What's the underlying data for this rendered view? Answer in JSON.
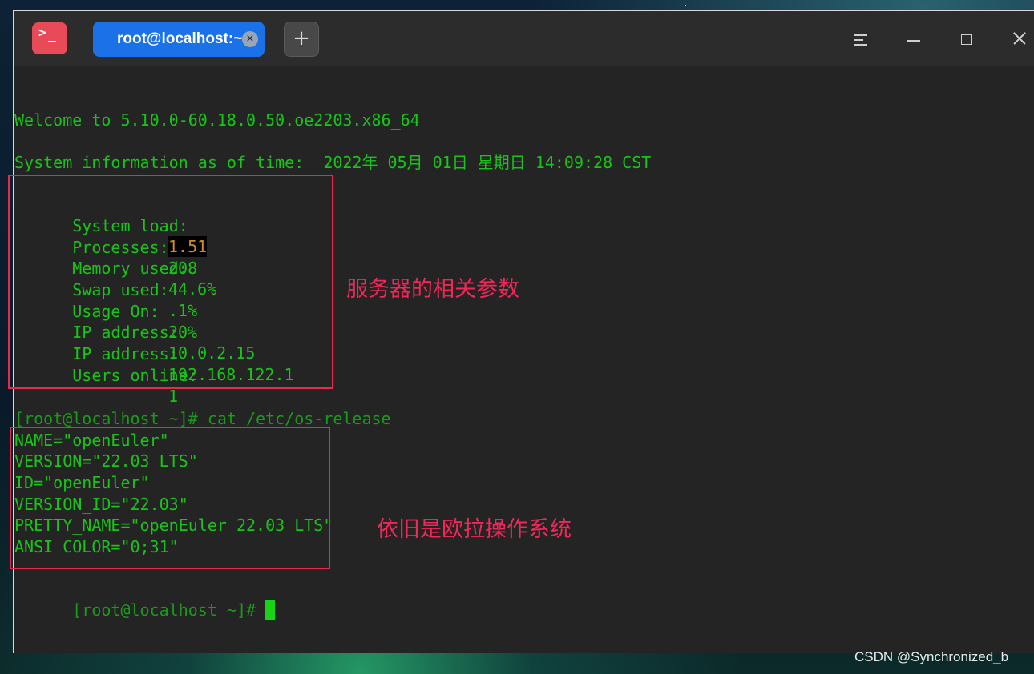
{
  "window": {
    "tab_title": "root@localhost:~",
    "tab_close_symbol": "×",
    "new_tab_symbol": "+"
  },
  "terminal": {
    "welcome": "Welcome to 5.10.0-60.18.0.50.oe2203.x86_64",
    "sysinfo": "System information as of time:  2022年 05月 01日 星期日 14:09:28 CST",
    "stats": [
      {
        "label": "System load:",
        "value": "1.51"
      },
      {
        "label": "Processes:",
        "value": "208"
      },
      {
        "label": "Memory used:",
        "value": "44.6%"
      },
      {
        "label": "Swap used:",
        "value": ".1%"
      },
      {
        "label": "Usage On:",
        "value": "20%"
      },
      {
        "label": "IP address:",
        "value": "10.0.2.15"
      },
      {
        "label": "IP address:",
        "value": "192.168.122.1"
      },
      {
        "label": "Users online:",
        "value": "1"
      }
    ],
    "prompt1": "[root@localhost ~]# cat /etc/os-release",
    "os_release": [
      "NAME=\"openEuler\"",
      "VERSION=\"22.03 LTS\"",
      "ID=\"openEuler\"",
      "VERSION_ID=\"22.03\"",
      "PRETTY_NAME=\"openEuler 22.03 LTS\"",
      "ANSI_COLOR=\"0;31\""
    ],
    "prompt2": "[root@localhost ~]# "
  },
  "annotations": {
    "server_params": "服务器的相关参数",
    "still_euler": "依旧是欧拉操作系统"
  },
  "watermark": "CSDN @Synchronized_b",
  "colors": {
    "terminal_text": "#19c419",
    "terminal_bg": "#242424",
    "tab_accent": "#1a71e8",
    "app_icon": "#e84a57",
    "callout": "#e8284c"
  }
}
